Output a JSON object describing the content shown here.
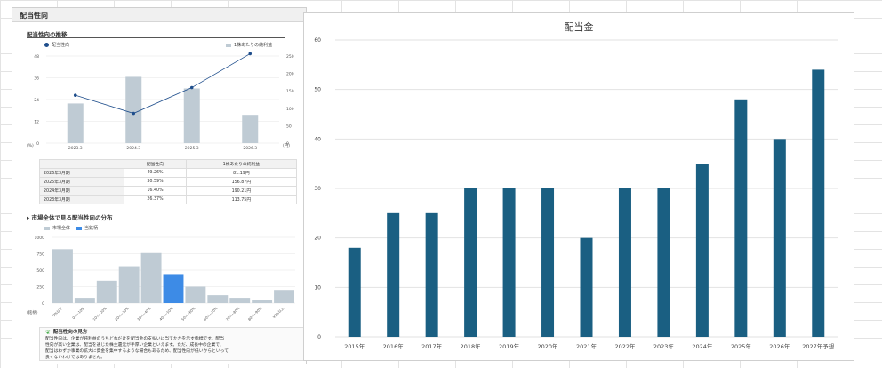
{
  "left": {
    "header": "配当性向",
    "trend_title": "配当性向の推移",
    "trend_legend": {
      "line": "配当性向",
      "bar": "1株あたりの純利益"
    },
    "trend_left_unit": "(%)",
    "trend_right_unit": "(円)",
    "trend_left_ticks": [
      "48",
      "36",
      "24",
      "12",
      "0"
    ],
    "trend_right_ticks": [
      "250",
      "200",
      "150",
      "100",
      "50",
      "0"
    ],
    "table": {
      "headers": [
        "",
        "配当性向",
        "1株あたりの純利益"
      ],
      "rows": [
        [
          "2026年3月期",
          "49.26%",
          "81.19円"
        ],
        [
          "2025年3月期",
          "30.59%",
          "156.87円"
        ],
        [
          "2024年3月期",
          "16.40%",
          "190.21円"
        ],
        [
          "2023年3月期",
          "26.37%",
          "113.75円"
        ]
      ]
    },
    "dist_title": "市場全体で見る配当性向の分布",
    "dist_legend": {
      "all": "市場全体",
      "self": "当銘柄"
    },
    "dist_ticks": [
      "1000",
      "750",
      "500",
      "250",
      "0"
    ],
    "dist_unit": "(銘柄)",
    "info_title": "配当性向の見方",
    "info_text_1": "配当性向は、企業が純利益のうちどれだけを配当金の支払いに当てたかを示す指標です。配当",
    "info_text_2": "性向が高い企業は、配当を通じた株主還元が手厚い企業といえます。ただ、成長中の企業で、",
    "info_text_3": "配当はわずか事業の拡大に資金を集中するような場合もあるため、配当性向が低いからといって",
    "info_text_4": "良くないわけではありません。"
  },
  "chart_data": [
    {
      "type": "bar+line",
      "title": "",
      "categories": [
        "2023.3",
        "2024.3",
        "2025.3",
        "2026.3"
      ],
      "series": [
        {
          "name": "配当性向",
          "axis": "left",
          "values": [
            26.37,
            16.4,
            30.59,
            49.26
          ]
        },
        {
          "name": "1株あたりの純利益",
          "axis": "right",
          "values": [
            113.75,
            190.21,
            156.87,
            81.19
          ]
        }
      ],
      "ylim_left": [
        0,
        48
      ],
      "ylim_right": [
        0,
        250
      ]
    },
    {
      "type": "bar",
      "title": "",
      "categories": [
        "0%以下",
        "0%~10%",
        "10%~20%",
        "20%~30%",
        "30%~40%",
        "40%~50%",
        "50%~60%",
        "60%~70%",
        "70%~80%",
        "80%~90%",
        "90%以上"
      ],
      "values": [
        820,
        80,
        340,
        560,
        760,
        440,
        250,
        120,
        80,
        50,
        200
      ],
      "highlight_index": 5,
      "ylim": [
        0,
        1000
      ]
    },
    {
      "type": "bar",
      "title": "配当金",
      "categories": [
        "2015年",
        "2016年",
        "2017年",
        "2018年",
        "2019年",
        "2020年",
        "2021年",
        "2022年",
        "2023年",
        "2024年",
        "2025年",
        "2026年",
        "2027年予想"
      ],
      "values": [
        18,
        25,
        25,
        30,
        30,
        30,
        20,
        30,
        30,
        35,
        48,
        40,
        54
      ],
      "ylim": [
        0,
        60
      ],
      "yticks": [
        0,
        10,
        20,
        30,
        40,
        50,
        60
      ],
      "grid": true,
      "color": "#1a5f82"
    }
  ]
}
